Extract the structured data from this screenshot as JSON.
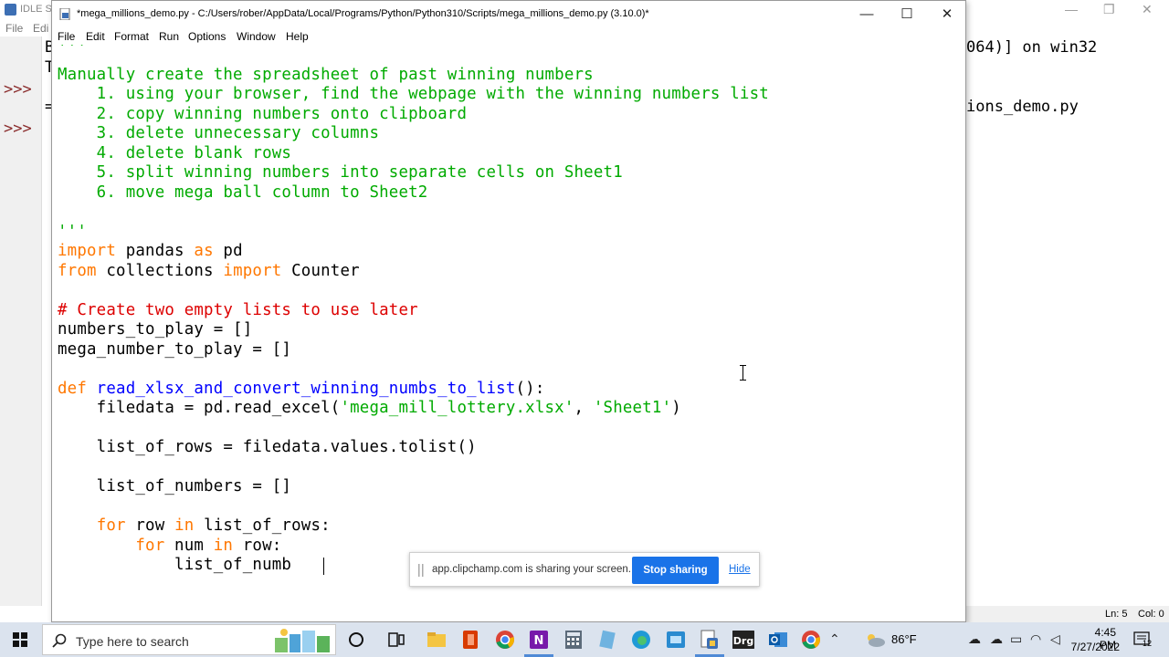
{
  "shell": {
    "title": "IDLE Sh",
    "menus": [
      "File",
      "Edi"
    ],
    "prompts": [
      ">>>",
      ">>>"
    ],
    "line1": "064)] on win32",
    "line2": "ions_demo.py",
    "frag1": "B",
    "frag2": "T",
    "frag3": "=",
    "status_ln": "Ln: 5",
    "status_col": "Col: 0"
  },
  "editor": {
    "title": "*mega_millions_demo.py - C:/Users/rober/AppData/Local/Programs/Python/Python310/Scripts/mega_millions_demo.py (3.10.0)*",
    "menus": [
      "File",
      "Edit",
      "Format",
      "Run",
      "Options",
      "Window",
      "Help"
    ],
    "controls": {
      "minimize": "—",
      "maximize": "☐",
      "close": "✕"
    },
    "code": {
      "l0": "'''",
      "l1": "Manually create the spreadsheet of past winning numbers",
      "l2": "    1. using your browser, find the webpage with the winning numbers list",
      "l3": "    2. copy winning numbers onto clipboard",
      "l4": "    3. delete unnecessary columns",
      "l5": "    4. delete blank rows",
      "l6": "    5. split winning numbers into separate cells on Sheet1",
      "l7": "    6. move mega ball column to Sheet2",
      "l9": "'''",
      "l10_kw": "import",
      "l10_a": " pandas ",
      "l10_kw2": "as",
      "l10_b": " pd",
      "l11_kw": "from",
      "l11_a": " collections ",
      "l11_kw2": "import",
      "l11_b": " Counter",
      "l13": "# Create two empty lists to use later",
      "l14": "numbers_to_play = []",
      "l15": "mega_number_to_play = []",
      "l17_kw": "def",
      "l17_name": " read_xlsx_and_convert_winning_numbs_to_list",
      "l17_rest": "():",
      "l18_a": "    filedata = pd.read_excel(",
      "l18_s1": "'mega_mill_lottery.xlsx'",
      "l18_b": ", ",
      "l18_s2": "'Sheet1'",
      "l18_c": ")",
      "l20": "    list_of_rows = filedata.values.tolist()",
      "l22": "    list_of_numbers = []",
      "l24_ind": "    ",
      "l24_kw": "for",
      "l24_a": " row ",
      "l24_kw2": "in",
      "l24_b": " list_of_rows:",
      "l25_ind": "        ",
      "l25_kw": "for",
      "l25_a": " num ",
      "l25_kw2": "in",
      "l25_b": " row:",
      "l26": "            list_of_numb"
    }
  },
  "share_popup": {
    "message": "app.clipchamp.com is sharing your screen.",
    "stop_label": "Stop sharing",
    "hide_label": "Hide"
  },
  "taskbar": {
    "search_placeholder": "Type here to search",
    "temperature": "86°F",
    "time": "4:45 PM",
    "date": "7/27/2022",
    "notification_count": "12",
    "icons": [
      "windows-start-icon",
      "cortana-icon",
      "task-view-icon",
      "file-explorer-icon",
      "office-icon",
      "chrome-icon",
      "onenote-icon",
      "calculator-icon",
      "notepad-icon",
      "edge-icon",
      "network-icon",
      "python-idle-icon",
      "drg-icon",
      "outlook-icon",
      "chrome-icon"
    ]
  }
}
